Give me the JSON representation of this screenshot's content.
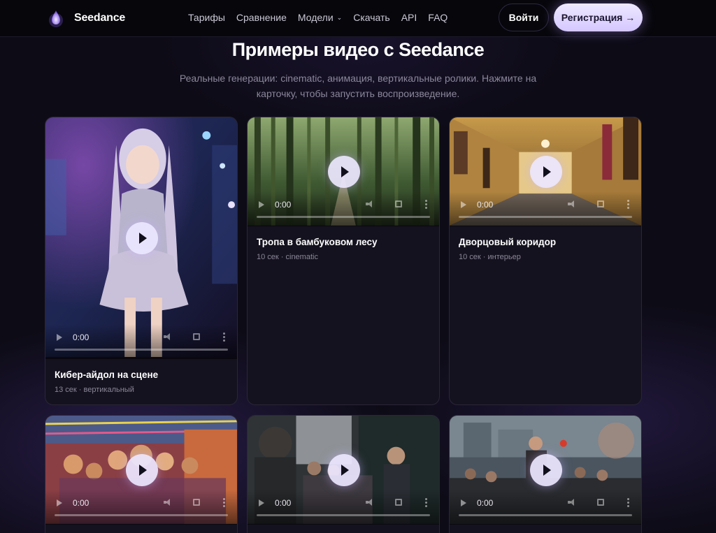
{
  "header": {
    "brand": "Seedance",
    "logo_icon": "droplet-logo-icon",
    "nav": [
      "Тарифы",
      "Сравнение",
      "Модели",
      "Скачать",
      "API",
      "FAQ"
    ],
    "login_label": "Войти",
    "register_label": "Регистрация →"
  },
  "hero": {
    "title": "Примеры видео с Seedance",
    "subtitle": "Реальные генерации: cinematic, анимация, вертикальные ролики. Нажмите на карточку, чтобы запустить воспроизведение."
  },
  "cards": [
    {
      "title": "Кибер-айдол на сцене",
      "meta": "13 сек · вертикальный",
      "time": "0:00"
    },
    {
      "title": "Тропа в бамбуковом лесу",
      "meta": "10 сек · cinematic",
      "time": "0:00"
    },
    {
      "title": "Дворцовый коридор",
      "meta": "10 сек · интерьер",
      "time": "0:00"
    },
    {
      "title": "",
      "meta": "",
      "time": "0:00"
    },
    {
      "title": "",
      "meta": "",
      "time": "0:00"
    },
    {
      "title": "",
      "meta": "",
      "time": "0:00"
    }
  ],
  "colors": {
    "accent": "#d9ccff",
    "background": "#0d0b16",
    "card": "#15121f"
  }
}
